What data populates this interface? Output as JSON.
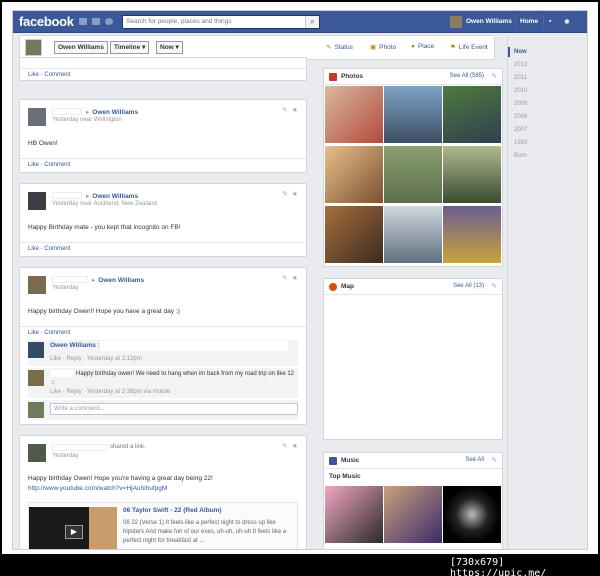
{
  "topbar": {
    "logo": "facebook",
    "search_placeholder": "Search for people, places and things",
    "user_name": "Owen Williams",
    "home_label": "Home"
  },
  "actionbar": {
    "name_label": "Owen Williams",
    "timeline_label": "Timeline",
    "now_label": "Now",
    "actions": [
      "Status",
      "Photo",
      "Place",
      "Life Event"
    ]
  },
  "top_story": {
    "like": "Like",
    "comment": "Comment"
  },
  "stories": [
    {
      "target": "Owen Williams",
      "time": "Yesterday near Wellington",
      "text": "HB Owen!",
      "like": "Like",
      "comment": "Comment"
    },
    {
      "target": "Owen Williams",
      "time": "Yesterday near Auckland, New Zealand",
      "text": "Happy Birthday mate - you kept that incognito on FB!",
      "like": "Like",
      "comment": "Comment"
    },
    {
      "target": "Owen Williams",
      "time": "Yesterday",
      "text": "Happy birthday Owen!! Hope you have a great day :)",
      "like": "Like",
      "comment": "Comment",
      "comments": [
        {
          "name": "Owen Williams",
          "sep": ":",
          "meta": "Like · Reply · Yesterday at 2:12pm"
        },
        {
          "text": "Happy birthday owen! We need to hang when im back from my road trip on like 12",
          "meta": "Like · Reply · Yesterday at 2:38pm via mobile"
        }
      ],
      "write_placeholder": "Write a comment..."
    },
    {
      "action": "shared a link.",
      "time": "Yesterday",
      "text": "Happy birthday Owen! Hope you're having a great day being 22!",
      "url": "http://www.youtube.com/watch?v=HjAuhihufpgM",
      "video_title": "06 Taylor Swift - 22 (Red Album)",
      "video_desc": "06 22 (Verse 1) It feels like a perfect night to dress up like hipsters And make fun of our exes, uh-uh, uh-uh It feels like a perfect night for breakfast at ..."
    }
  ],
  "photos_panel": {
    "title": "Photos",
    "see_all": "See All (585)"
  },
  "map_panel": {
    "title": "Map",
    "see_all": "See All (13)"
  },
  "music_panel": {
    "title": "Music",
    "see_all": "See All",
    "subtitle": "Top Music"
  },
  "years": [
    "Now",
    "2012",
    "2011",
    "2010",
    "2009",
    "2008",
    "2007",
    "1993",
    "Born"
  ],
  "watermark": "[730x679] https://upic.me/",
  "colors": {
    "fb_blue": "#3b5998",
    "background": "#e9ebee"
  }
}
